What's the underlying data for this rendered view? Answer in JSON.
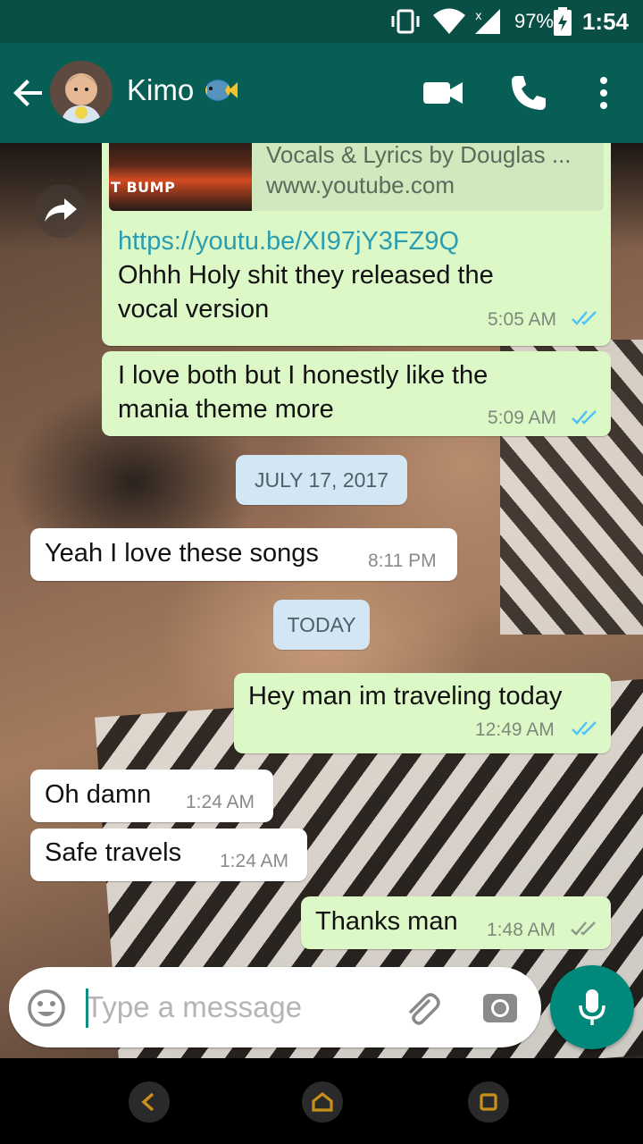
{
  "status_bar": {
    "battery": "97%",
    "time": "1:54"
  },
  "header": {
    "contact_name": "Kimo"
  },
  "link_preview": {
    "thumbnail_label": "T BUMP",
    "description": "Vocals & Lyrics by Douglas ...",
    "site": "www.youtube.com"
  },
  "messages": [
    {
      "direction": "out",
      "link": "https://youtu.be/XI97jY3FZ9Q",
      "lines": [
        "Ohhh Holy shit they released the",
        "vocal version"
      ],
      "time": "5:05 AM",
      "status": "read"
    },
    {
      "direction": "out",
      "lines": [
        "I love both but I honestly like the",
        "mania theme more"
      ],
      "time": "5:09 AM",
      "status": "read"
    },
    {
      "date": "JULY 17, 2017"
    },
    {
      "direction": "in",
      "lines": [
        "Yeah I love these songs"
      ],
      "time": "8:11 PM"
    },
    {
      "date": "TODAY"
    },
    {
      "direction": "out",
      "lines": [
        "Hey man im traveling today"
      ],
      "time": "12:49 AM",
      "status": "read"
    },
    {
      "direction": "in",
      "lines": [
        "Oh damn"
      ],
      "time": "1:24 AM"
    },
    {
      "direction": "in",
      "lines": [
        "Safe travels"
      ],
      "time": "1:24 AM"
    },
    {
      "direction": "out",
      "lines": [
        "Thanks man"
      ],
      "time": "1:48 AM",
      "status": "delivered"
    }
  ],
  "composer": {
    "placeholder": "Type a message"
  },
  "colors": {
    "header": "#075e54",
    "status_bar": "#0a4f45",
    "outgoing_bubble": "#dcf8c6",
    "read_tick": "#4fc3f7",
    "mic_button": "#00897b"
  }
}
